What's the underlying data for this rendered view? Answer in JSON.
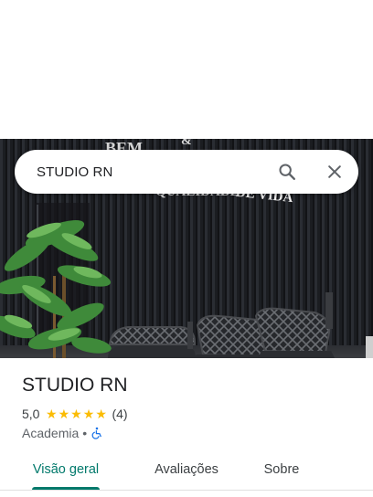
{
  "search": {
    "query": "STUDIO RN"
  },
  "place": {
    "title": "STUDIO RN",
    "rating": "5,0",
    "stars": 5,
    "reviews": "(4)",
    "category": "Academia",
    "separator": "•"
  },
  "tabs": [
    {
      "label": "Visão geral",
      "active": true
    },
    {
      "label": "Avaliações",
      "active": false
    },
    {
      "label": "Sobre",
      "active": false
    }
  ],
  "colors": {
    "accent": "#00796b",
    "star": "#fbbc04",
    "accessibility": "#1a73e8"
  },
  "icons": {
    "search": "search-icon",
    "close": "close-icon",
    "accessibility": "wheelchair-icon"
  }
}
